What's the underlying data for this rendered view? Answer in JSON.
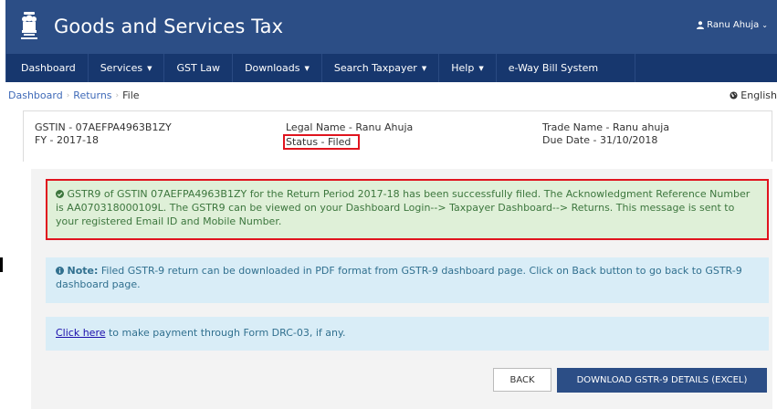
{
  "header": {
    "app_title": "Goods and Services Tax",
    "user_name": "Ranu Ahuja",
    "user_icon": "user-icon",
    "caret_icon": "chevron-down-icon",
    "brand_color": "#2c4e86"
  },
  "nav": {
    "items": [
      {
        "label": "Dashboard",
        "dropdown": false
      },
      {
        "label": "Services",
        "dropdown": true
      },
      {
        "label": "GST Law",
        "dropdown": false
      },
      {
        "label": "Downloads",
        "dropdown": true
      },
      {
        "label": "Search Taxpayer",
        "dropdown": true
      },
      {
        "label": "Help",
        "dropdown": true
      },
      {
        "label": "e-Way Bill System",
        "dropdown": false
      }
    ],
    "bg_color": "#17376e"
  },
  "breadcrumb": {
    "items": [
      "Dashboard",
      "Returns",
      "File"
    ],
    "language": "English",
    "language_icon": "globe-icon"
  },
  "info": {
    "gstin": "GSTIN - 07AEFPA4963B1ZY",
    "fy": "FY - 2017-18",
    "legal_name": "Legal Name - Ranu Ahuja",
    "status": "Status - Filed",
    "trade_name": "Trade Name - Ranu ahuja",
    "due_date": "Due Date - 31/10/2018"
  },
  "success_message": {
    "icon": "check-circle-icon",
    "text": "GSTR9 of GSTIN 07AEFPA4963B1ZY for the Return Period 2017-18 has been successfully filed. The Acknowledgment Reference Number is AA070318000109L. The GSTR9 can be viewed on your Dashboard Login--> Taxpayer Dashboard--> Returns. This message is sent to your registered Email ID and Mobile Number."
  },
  "note": {
    "icon": "info-circle-icon",
    "label": "Note:",
    "text": " Filed GSTR-9 return can be downloaded in PDF format from GSTR-9 dashboard page. Click on Back button to go back to GSTR-9 dashboard page."
  },
  "payment": {
    "link_text": "Click here",
    "text": " to make payment through Form DRC-03, if any."
  },
  "buttons": {
    "back": "BACK",
    "download": "DOWNLOAD GSTR-9 DETAILS (EXCEL)"
  }
}
